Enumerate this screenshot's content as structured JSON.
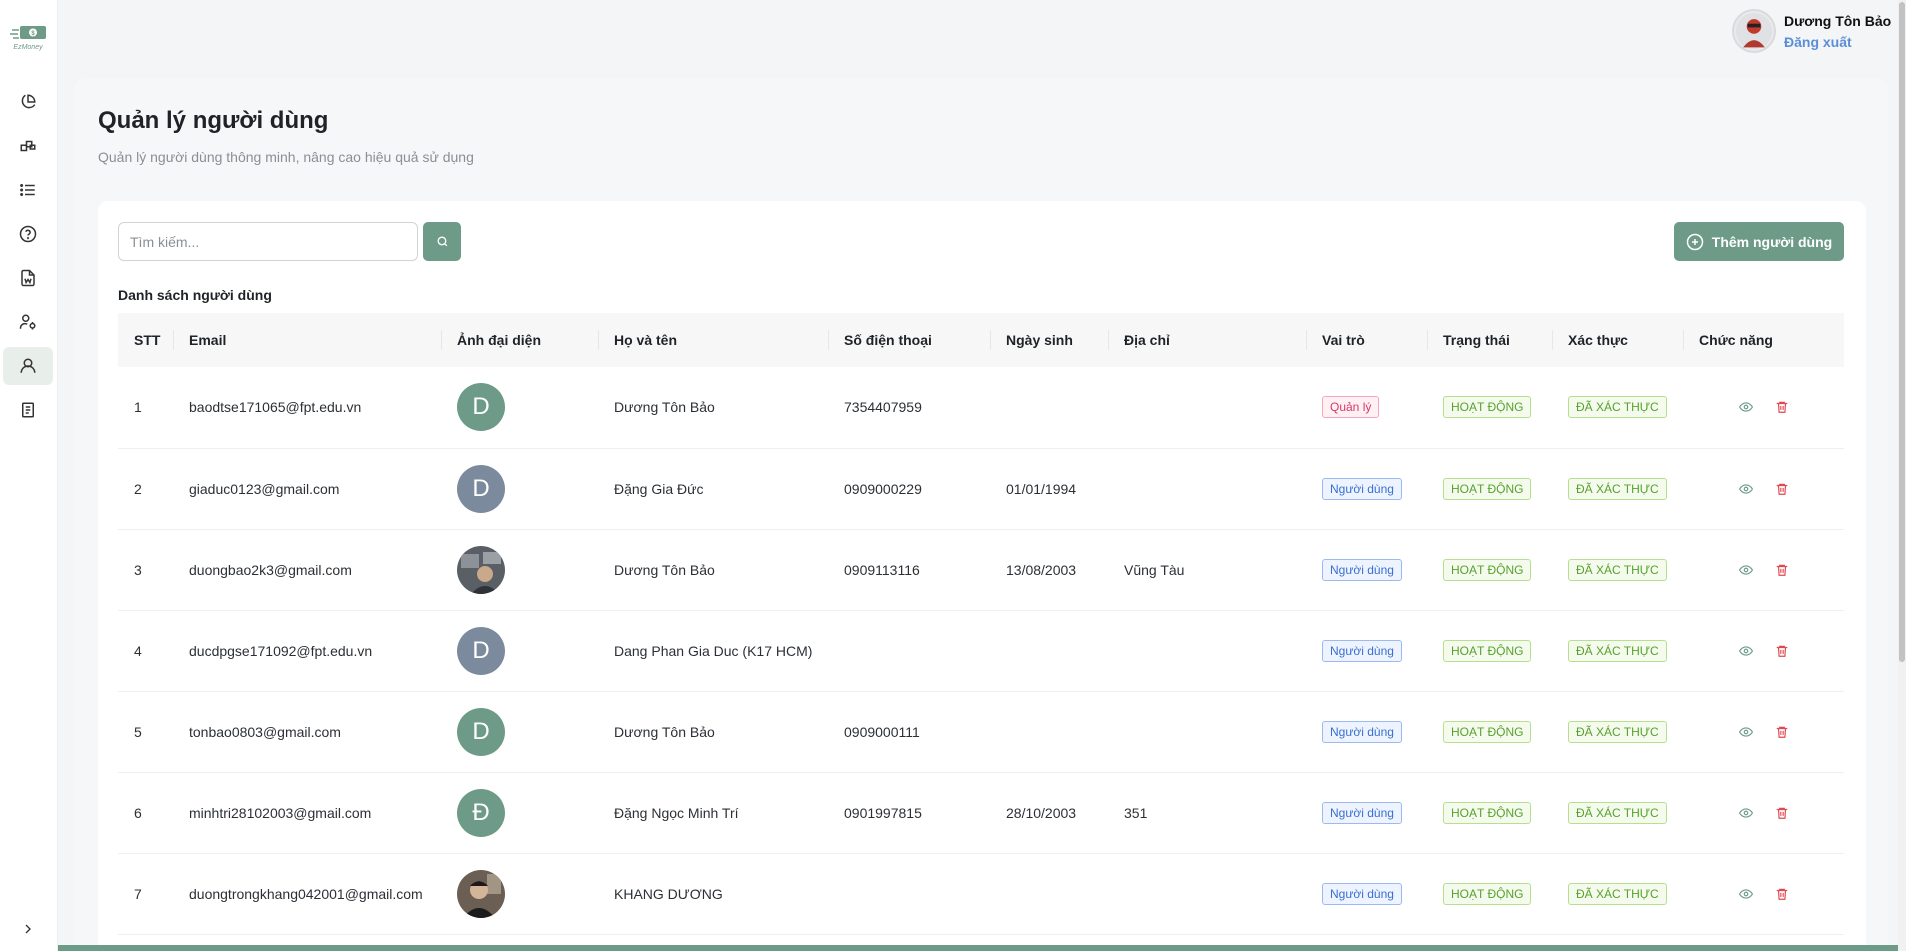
{
  "app": {
    "logo_text": "EzMoney",
    "brand_color": "#6e9a88"
  },
  "sidebar": {
    "items": [
      {
        "icon": "pie-chart-icon",
        "active": false
      },
      {
        "icon": "blocks-icon",
        "active": false
      },
      {
        "icon": "list-icon",
        "active": false
      },
      {
        "icon": "help-circle-icon",
        "active": false
      },
      {
        "icon": "document-icon",
        "active": false
      },
      {
        "icon": "users-cog-icon",
        "active": false
      },
      {
        "icon": "user-icon",
        "active": true
      },
      {
        "icon": "receipt-icon",
        "active": false
      }
    ],
    "collapse_icon": "chevron-right-icon"
  },
  "user": {
    "name": "Dương Tôn Bảo",
    "logout_label": "Đăng xuất"
  },
  "page": {
    "title": "Quản lý người dùng",
    "subtitle": "Quản lý người dùng thông minh, nâng cao hiệu quả sử dụng"
  },
  "toolbar": {
    "search_placeholder": "Tìm kiếm...",
    "add_label": "Thêm người dùng"
  },
  "table": {
    "title": "Danh sách người dùng",
    "columns": [
      "STT",
      "Email",
      "Ảnh đại diện",
      "Họ và tên",
      "Số điện thoại",
      "Ngày sinh",
      "Địa chỉ",
      "Vai trò",
      "Trạng thái",
      "Xác thực",
      "Chức năng"
    ],
    "rows": [
      {
        "stt": "1",
        "email": "baodtse171065@fpt.edu.vn",
        "avatar_letter": "D",
        "avatar_color": "#6e9a88",
        "avatar_photo": false,
        "name": "Dương Tôn Bảo",
        "phone": "7354407959",
        "dob": "",
        "address": "",
        "role": "Quản lý",
        "role_type": "admin",
        "status": "HOẠT ĐỘNG",
        "verified": "ĐÃ XÁC THỰC"
      },
      {
        "stt": "2",
        "email": "giaduc0123@gmail.com",
        "avatar_letter": "D",
        "avatar_color": "#7b8a9c",
        "avatar_photo": false,
        "name": "Đặng Gia Đức",
        "phone": "0909000229",
        "dob": "01/01/1994",
        "address": "",
        "role": "Người dùng",
        "role_type": "user",
        "status": "HOẠT ĐỘNG",
        "verified": "ĐÃ XÁC THỰC"
      },
      {
        "stt": "3",
        "email": "duongbao2k3@gmail.com",
        "avatar_letter": "",
        "avatar_color": "#4a4a4a",
        "avatar_photo": true,
        "name": "Dương Tôn Bảo",
        "phone": "0909113116",
        "dob": "13/08/2003",
        "address": "Vũng Tàu",
        "role": "Người dùng",
        "role_type": "user",
        "status": "HOẠT ĐỘNG",
        "verified": "ĐÃ XÁC THỰC"
      },
      {
        "stt": "4",
        "email": "ducdpgse171092@fpt.edu.vn",
        "avatar_letter": "D",
        "avatar_color": "#7b8a9c",
        "avatar_photo": false,
        "name": "Dang Phan Gia Duc (K17 HCM)",
        "phone": "",
        "dob": "",
        "address": "",
        "role": "Người dùng",
        "role_type": "user",
        "status": "HOẠT ĐỘNG",
        "verified": "ĐÃ XÁC THỰC"
      },
      {
        "stt": "5",
        "email": "tonbao0803@gmail.com",
        "avatar_letter": "D",
        "avatar_color": "#6e9a88",
        "avatar_photo": false,
        "name": "Dương Tôn Bảo",
        "phone": "0909000111",
        "dob": "",
        "address": "",
        "role": "Người dùng",
        "role_type": "user",
        "status": "HOẠT ĐỘNG",
        "verified": "ĐÃ XÁC THỰC"
      },
      {
        "stt": "6",
        "email": "minhtri28102003@gmail.com",
        "avatar_letter": "Đ",
        "avatar_color": "#6e9a88",
        "avatar_photo": false,
        "name": "Đặng Ngọc Minh Trí",
        "phone": "0901997815",
        "dob": "28/10/2003",
        "address": "351",
        "role": "Người dùng",
        "role_type": "user",
        "status": "HOẠT ĐỘNG",
        "verified": "ĐÃ XÁC THỰC"
      },
      {
        "stt": "7",
        "email": "duongtrongkhang042001@gmail.com",
        "avatar_letter": "",
        "avatar_color": "#3a3a3a",
        "avatar_photo": true,
        "name": "KHANG DƯƠNG",
        "phone": "",
        "dob": "",
        "address": "",
        "role": "Người dùng",
        "role_type": "user",
        "status": "HOẠT ĐỘNG",
        "verified": "ĐÃ XÁC THỰC"
      }
    ],
    "action_icons": [
      "eye-icon",
      "trash-icon"
    ]
  }
}
